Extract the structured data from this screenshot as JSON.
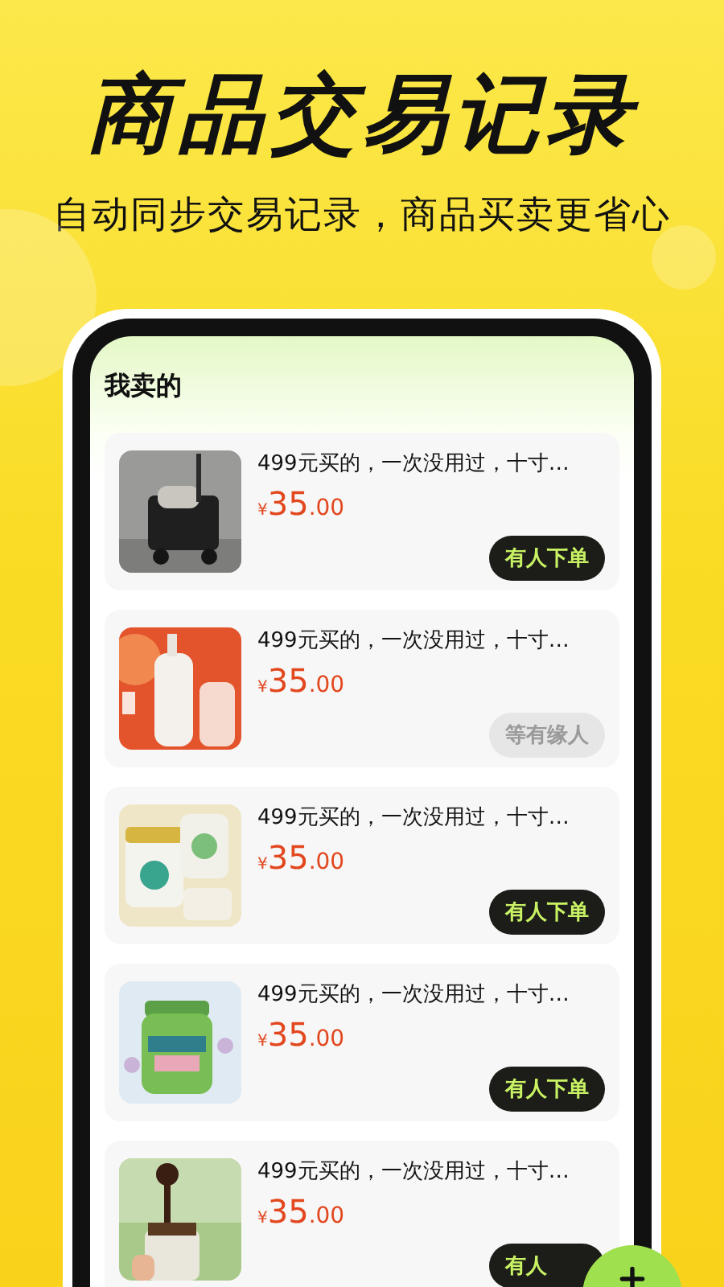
{
  "headline": "商品交易记录",
  "subtitle": "自动同步交易记录，商品买卖更省心",
  "section_title": "我卖的",
  "items": [
    {
      "title": "499元买的，一次没用过，十寸…",
      "currency": "¥",
      "price_whole": "35",
      "price_decimal": ".00",
      "status": {
        "kind": "ordered",
        "label": "有人下单"
      }
    },
    {
      "title": "499元买的，一次没用过，十寸…",
      "currency": "¥",
      "price_whole": "35",
      "price_decimal": ".00",
      "status": {
        "kind": "waiting",
        "label": "等有缘人"
      }
    },
    {
      "title": "499元买的，一次没用过，十寸…",
      "currency": "¥",
      "price_whole": "35",
      "price_decimal": ".00",
      "status": {
        "kind": "ordered",
        "label": "有人下单"
      }
    },
    {
      "title": "499元买的，一次没用过，十寸…",
      "currency": "¥",
      "price_whole": "35",
      "price_decimal": ".00",
      "status": {
        "kind": "ordered",
        "label": "有人下单"
      }
    },
    {
      "title": "499元买的，一次没用过，十寸…",
      "currency": "¥",
      "price_whole": "35",
      "price_decimal": ".00",
      "status": {
        "kind": "ordered",
        "label": "有人"
      }
    }
  ]
}
